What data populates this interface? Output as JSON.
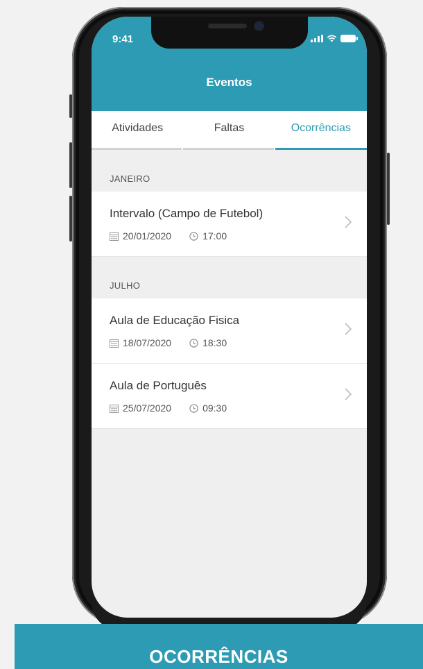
{
  "status_bar": {
    "time": "9:41"
  },
  "header": {
    "title": "Eventos"
  },
  "tabs": [
    {
      "label": "Atividades",
      "active": false
    },
    {
      "label": "Faltas",
      "active": false
    },
    {
      "label": "Ocorrências",
      "active": true
    }
  ],
  "sections": [
    {
      "month": "JANEIRO",
      "items": [
        {
          "title": "Intervalo (Campo de Futebol)",
          "date": "20/01/2020",
          "time": "17:00"
        }
      ]
    },
    {
      "month": "JULHO",
      "items": [
        {
          "title": "Aula de Educação Fisica",
          "date": "18/07/2020",
          "time": "18:30"
        },
        {
          "title": "Aula de Português",
          "date": "25/07/2020",
          "time": "09:30"
        }
      ]
    }
  ],
  "banner": {
    "label": "OCORRÊNCIAS"
  },
  "colors": {
    "accent": "#2d9bb3",
    "background": "#efefef"
  },
  "icons": [
    "signal-icon",
    "wifi-icon",
    "battery-icon",
    "calendar-icon",
    "clock-icon",
    "chevron-right-icon"
  ]
}
